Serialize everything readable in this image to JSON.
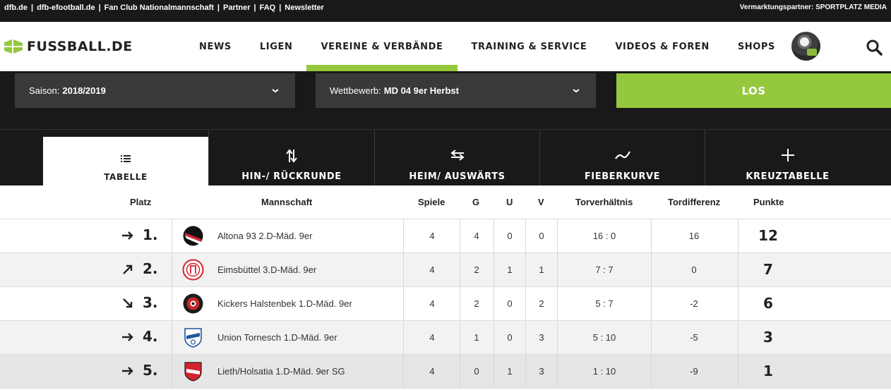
{
  "topbar": {
    "links": [
      "dfb.de",
      "dfb-efootball.de",
      "Fan Club Nationalmannschaft",
      "Partner",
      "FAQ",
      "Newsletter"
    ],
    "separator": "|",
    "partner_label": "Vermarktungspartner:",
    "partner_name": "SPORTPLATZ MEDIA"
  },
  "header": {
    "logo_text": "FUSSBALL.DE",
    "nav": [
      "NEWS",
      "LIGEN",
      "VEREINE & VERBÄNDE",
      "TRAINING & SERVICE",
      "VIDEOS & FOREN",
      "SHOPS"
    ],
    "active_nav": "VEREINE & VERBÄNDE"
  },
  "filters": {
    "saison_label": "Saison:",
    "saison_value": "2018/2019",
    "wettbewerb_label": "Wettbewerb:",
    "wettbewerb_value": "MD 04 9er Herbst",
    "submit_label": "LOS"
  },
  "tabs": [
    {
      "label": "TABELLE",
      "icon": "list-icon",
      "active": true
    },
    {
      "label": "HIN-/ RÜCKRUNDE",
      "icon": "swap-vertical-icon",
      "active": false
    },
    {
      "label": "HEIM/ AUSWÄRTS",
      "icon": "swap-horizontal-icon",
      "active": false
    },
    {
      "label": "FIEBERKURVE",
      "icon": "trend-line-icon",
      "active": false
    },
    {
      "label": "KREUZTABELLE",
      "icon": "plus-icon",
      "active": false
    }
  ],
  "table": {
    "headers": {
      "platz": "Platz",
      "mannschaft": "Mannschaft",
      "spiele": "Spiele",
      "g": "G",
      "u": "U",
      "v": "V",
      "torverhaeltnis": "Torverhältnis",
      "tordifferenz": "Tordifferenz",
      "punkte": "Punkte"
    },
    "rows": [
      {
        "trend": "same",
        "rank": "1.",
        "team": "Altona 93 2.D-Mäd. 9er",
        "crest": "altona-crest-icon",
        "spiele": "4",
        "g": "4",
        "u": "0",
        "v": "0",
        "tore": "16 : 0",
        "diff": "16",
        "punkte": "12"
      },
      {
        "trend": "up",
        "rank": "2.",
        "team": "Eimsbüttel 3.D-Mäd. 9er",
        "crest": "etv-crest-icon",
        "spiele": "4",
        "g": "2",
        "u": "1",
        "v": "1",
        "tore": "7 : 7",
        "diff": "0",
        "punkte": "7"
      },
      {
        "trend": "down",
        "rank": "3.",
        "team": "Kickers Halstenbek 1.D-Mäd. 9er",
        "crest": "kickers-crest-icon",
        "spiele": "4",
        "g": "2",
        "u": "0",
        "v": "2",
        "tore": "5 : 7",
        "diff": "-2",
        "punkte": "6"
      },
      {
        "trend": "same",
        "rank": "4.",
        "team": "Union Tornesch 1.D-Mäd. 9er",
        "crest": "union-crest-icon",
        "spiele": "4",
        "g": "1",
        "u": "0",
        "v": "3",
        "tore": "5 : 10",
        "diff": "-5",
        "punkte": "3"
      },
      {
        "trend": "same",
        "rank": "5.",
        "team": "Lieth/Holsatia 1.D-Mäd. 9er SG",
        "crest": "lieth-crest-icon",
        "spiele": "4",
        "g": "0",
        "u": "1",
        "v": "3",
        "tore": "1 : 10",
        "diff": "-9",
        "punkte": "1"
      }
    ]
  },
  "colors": {
    "accent": "#94c83d",
    "dark": "#191919",
    "select_bg": "#393939"
  }
}
